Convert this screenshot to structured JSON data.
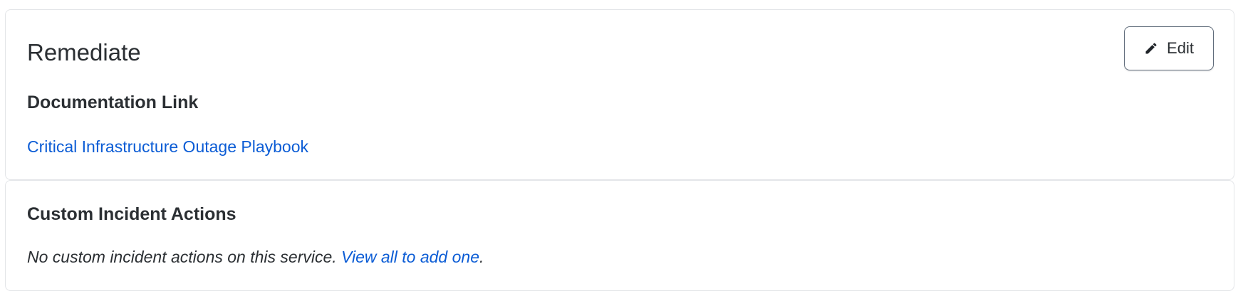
{
  "remediate": {
    "title": "Remediate",
    "edit_label": "Edit",
    "edit_icon": "pencil-icon",
    "documentation": {
      "heading": "Documentation Link",
      "link_text": "Critical Infrastructure Outage Playbook"
    }
  },
  "custom_actions": {
    "heading": "Custom Incident Actions",
    "empty_text": "No custom incident actions on this service. ",
    "view_all_link": "View all to add one",
    "trailing_punct": "."
  },
  "colors": {
    "link": "#0b5cd5",
    "text": "#2b2f33",
    "border": "#e3e5e8",
    "button_border": "#5f6b7a"
  }
}
